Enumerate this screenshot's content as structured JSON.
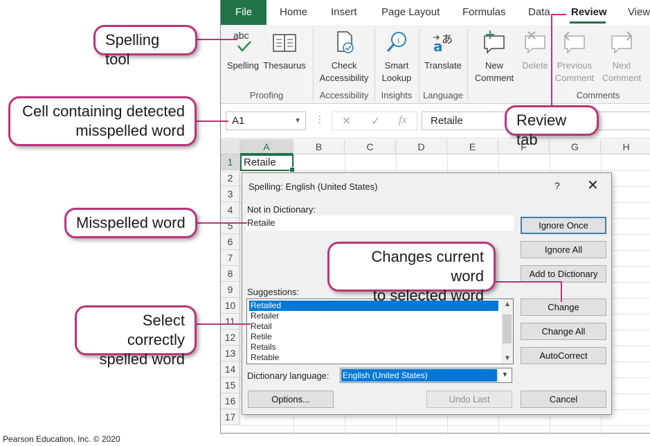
{
  "ribbon_tabs": [
    "File",
    "Home",
    "Insert",
    "Page Layout",
    "Formulas",
    "Data",
    "Review",
    "View"
  ],
  "ribbon": {
    "proofing": {
      "group_label": "Proofing",
      "spelling_label": "Spelling",
      "thesaurus_label": "Thesaurus",
      "spelling_icon_text": "abc"
    },
    "accessibility": {
      "group_label": "Accessibility",
      "check_line1": "Check",
      "check_line2": "Accessibility"
    },
    "insights": {
      "group_label": "Insights",
      "smart_line1": "Smart",
      "smart_line2": "Lookup"
    },
    "language": {
      "group_label": "Language",
      "translate_label": "Translate"
    },
    "comments": {
      "group_label": "Comments",
      "new_line1": "New",
      "new_line2": "Comment",
      "delete_label": "Delete",
      "prev_line1": "Previous",
      "prev_line2": "Comment",
      "next_line1": "Next",
      "next_line2": "Comment"
    }
  },
  "formula_bar": {
    "name_box": "A1",
    "content": "Retaile",
    "fx": "fx"
  },
  "sheet": {
    "columns": [
      "A",
      "B",
      "C",
      "D",
      "E",
      "F",
      "G",
      "H"
    ],
    "rows": [
      "1",
      "2",
      "3",
      "4",
      "5",
      "6",
      "7",
      "8",
      "9",
      "10",
      "11",
      "12",
      "13",
      "14",
      "15",
      "16",
      "17"
    ],
    "a1_value": "Retaile"
  },
  "dialog": {
    "title": "Spelling: English (United States)",
    "help": "?",
    "close": "✕",
    "not_in_dictionary_label": "Not in Dictionary:",
    "not_in_dictionary_value": "Retaile",
    "suggestions_label": "Suggestions:",
    "suggestions": [
      "Retailed",
      "Retailer",
      "Retail",
      "Retile",
      "Retails",
      "Retable"
    ],
    "dictionary_language_label": "Dictionary language:",
    "dictionary_language_value": "English (United States)",
    "buttons": {
      "ignore_once": "Ignore Once",
      "ignore_all": "Ignore All",
      "add_to_dictionary": "Add to Dictionary",
      "change": "Change",
      "change_all": "Change All",
      "autocorrect": "AutoCorrect",
      "options": "Options...",
      "undo_last": "Undo Last",
      "cancel": "Cancel"
    }
  },
  "callouts": {
    "spelling_tool": "Spelling tool",
    "cell_line1": "Cell containing detected",
    "cell_line2": "misspelled word",
    "misspelled": "Misspelled word",
    "select_line1": "Select correctly",
    "select_line2": "spelled word",
    "changes_line1": "Changes current word",
    "changes_line2": "to selected word",
    "review_tab": "Review tab"
  },
  "footer": "Pearson Education, Inc. © 2020",
  "colors": {
    "excel_green": "#217346",
    "callout_border": "#b8357a",
    "selection_blue": "#0078d7"
  }
}
